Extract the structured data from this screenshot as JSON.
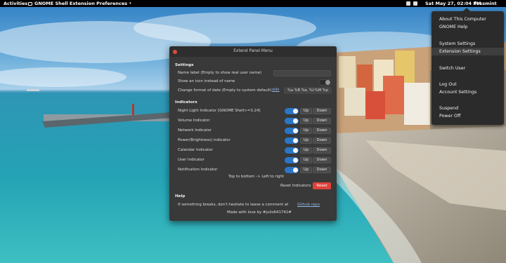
{
  "topbar": {
    "activities": "Activities",
    "app_menu": "GNOME Shell Extension Preferences",
    "clock": "Sat May 27, 02:04 PM",
    "user": "fossmint"
  },
  "system_menu": {
    "items": [
      "About This Computer",
      "GNOME Help",
      "System Settings",
      "Extension Settings",
      "Switch User",
      "Log Out",
      "Account Settings",
      "Suspend",
      "Power Off"
    ],
    "active": "Extension Settings"
  },
  "dialog": {
    "title": "Extend Panel Menu",
    "settings": {
      "heading": "Settings",
      "name_label": "Name label (Empty to show real user name)",
      "name_value": "",
      "show_icon": "Show an icon instead of name",
      "show_icon_on": false,
      "date_format_label": "Change format of date (Empty to system default)",
      "wiki_link": "wiki",
      "date_format_value": "%a %B %e, %l:%M %p"
    },
    "indicators": {
      "heading": "Indicators",
      "up_label": "Up",
      "down_label": "Down",
      "items": [
        "Night Light Indicator [GNOME Shell>=3.24]",
        "Volume Indicator",
        "Network Indicator",
        "Power(Brightness) indicator",
        "Calendar Indicator",
        "User Indicator",
        "Notification Indicator"
      ],
      "order_note": "Top to bottom -> Left to right",
      "reset_label": "Reset Indicators",
      "reset_button": "Reset"
    },
    "help": {
      "heading": "Help",
      "text": "If something breaks, don't hesitate to leave a comment at",
      "link": "Github repo",
      "credit": "Made with love by #julio641742#"
    }
  },
  "colors": {
    "accent": "#2a76c6",
    "reset": "#e0413b",
    "dialog_bg": "#393939",
    "menu_bg": "#2b2b2b"
  }
}
